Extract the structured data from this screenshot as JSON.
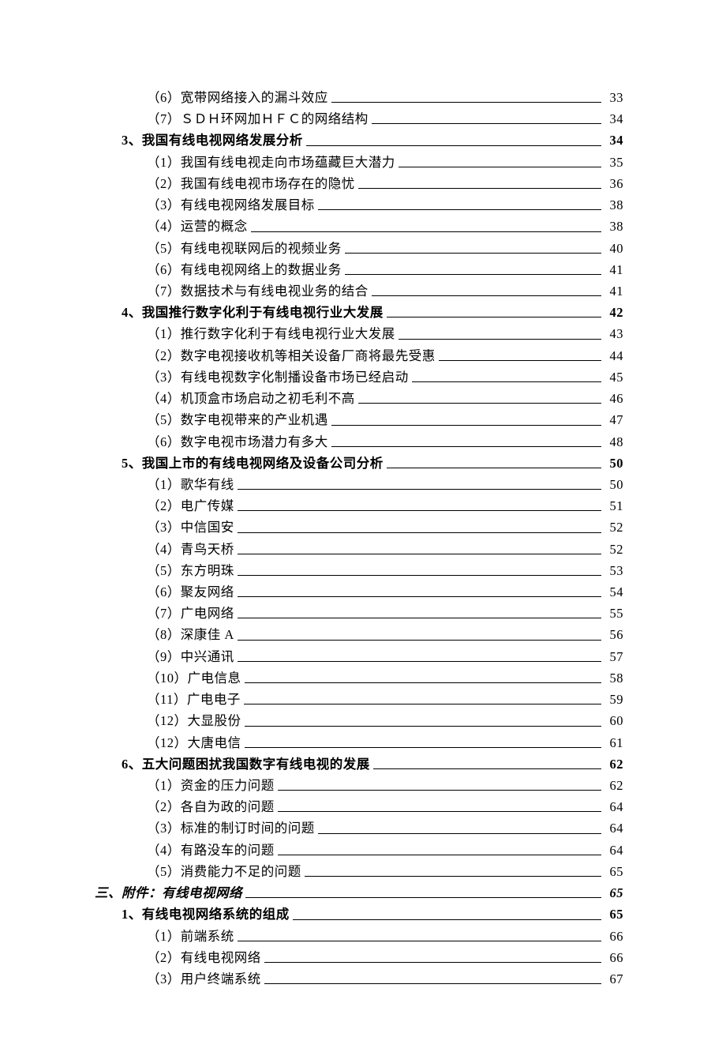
{
  "entries": [
    {
      "level": 3,
      "title": "（6）宽带网络接入的漏斗效应",
      "page": "33"
    },
    {
      "level": 3,
      "title": "（7）ＳＤＨ环网加ＨＦＣ的网络结构",
      "page": "34"
    },
    {
      "level": 2,
      "title": "3、我国有线电视网络发展分析",
      "page": "34"
    },
    {
      "level": 3,
      "title": "（1）我国有线电视走向市场蕴藏巨大潜力",
      "page": "35"
    },
    {
      "level": 3,
      "title": "（2）我国有线电视市场存在的隐忧",
      "page": "36"
    },
    {
      "level": 3,
      "title": "（3）有线电视网络发展目标",
      "page": "38"
    },
    {
      "level": 3,
      "title": "（4）运营的概念",
      "page": "38"
    },
    {
      "level": 3,
      "title": "（5）有线电视联网后的视频业务",
      "page": "40"
    },
    {
      "level": 3,
      "title": "（6）有线电视网络上的数据业务",
      "page": "41"
    },
    {
      "level": 3,
      "title": "（7）数据技术与有线电视业务的结合",
      "page": "41"
    },
    {
      "level": 2,
      "title": "4、我国推行数字化利于有线电视行业大发展",
      "page": "42"
    },
    {
      "level": 3,
      "title": "（1）推行数字化利于有线电视行业大发展",
      "page": "43"
    },
    {
      "level": 3,
      "title": "（2）数字电视接收机等相关设备厂商将最先受惠",
      "page": "44"
    },
    {
      "level": 3,
      "title": "（3）有线电视数字化制播设备市场已经启动",
      "page": "45"
    },
    {
      "level": 3,
      "title": "（4）机顶盒市场启动之初毛利不高",
      "page": "46"
    },
    {
      "level": 3,
      "title": "（5）数字电视带来的产业机遇",
      "page": "47"
    },
    {
      "level": 3,
      "title": "（6）数字电视市场潜力有多大",
      "page": "48"
    },
    {
      "level": 2,
      "title": "5、我国上市的有线电视网络及设备公司分析",
      "page": "50"
    },
    {
      "level": 3,
      "title": "（1）歌华有线",
      "page": "50"
    },
    {
      "level": 3,
      "title": "（2）电广传媒",
      "page": "51"
    },
    {
      "level": 3,
      "title": "（3）中信国安",
      "page": "52"
    },
    {
      "level": 3,
      "title": "（4）青鸟天桥",
      "page": "52"
    },
    {
      "level": 3,
      "title": "（5）东方明珠",
      "page": "53"
    },
    {
      "level": 3,
      "title": "（6）聚友网络",
      "page": "54"
    },
    {
      "level": 3,
      "title": "（7）广电网络",
      "page": "55"
    },
    {
      "level": 3,
      "title": "（8）深康佳 A",
      "page": "56"
    },
    {
      "level": 3,
      "title": "（9）中兴通讯",
      "page": "57"
    },
    {
      "level": 3,
      "title": "（10）广电信息",
      "page": "58"
    },
    {
      "level": 3,
      "title": "（11）广电电子",
      "page": "59"
    },
    {
      "level": 3,
      "title": "（12）大显股份",
      "page": "60"
    },
    {
      "level": 3,
      "title": "（12）大唐电信",
      "page": "61"
    },
    {
      "level": 2,
      "title": "6、五大问题困扰我国数字有线电视的发展",
      "page": "62"
    },
    {
      "level": 3,
      "title": "（1）资金的压力问题",
      "page": "62"
    },
    {
      "level": 3,
      "title": "（2）各自为政的问题",
      "page": "64"
    },
    {
      "level": 3,
      "title": "（3）标准的制订时间的问题",
      "page": "64"
    },
    {
      "level": 3,
      "title": "（4）有路没车的问题",
      "page": "64"
    },
    {
      "level": 3,
      "title": "（5）消费能力不足的问题",
      "page": "65"
    },
    {
      "level": 1,
      "title": "三、附件：有线电视网络",
      "page": "65"
    },
    {
      "level": 2,
      "title": "1、有线电视网络系统的组成",
      "page": "65"
    },
    {
      "level": 3,
      "title": "（1）前端系统",
      "page": "66"
    },
    {
      "level": 3,
      "title": "（2）有线电视网络",
      "page": "66"
    },
    {
      "level": 3,
      "title": "（3）用户终端系统",
      "page": "67"
    }
  ]
}
